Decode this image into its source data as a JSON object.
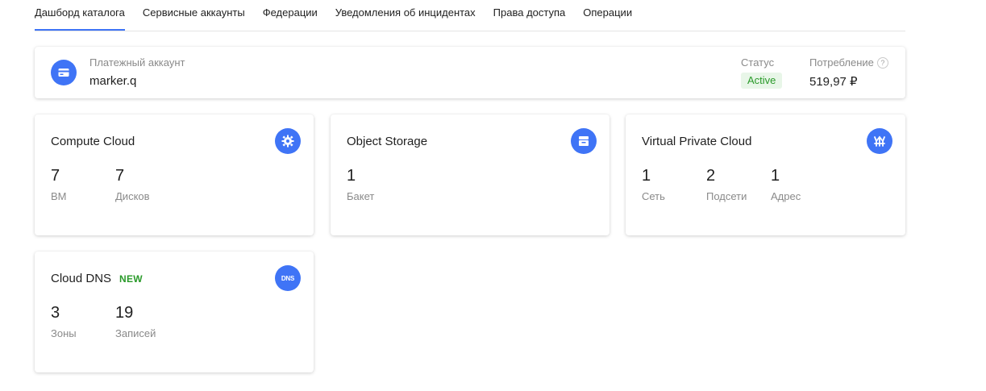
{
  "tabs": [
    {
      "label": "Дашборд каталога",
      "active": true
    },
    {
      "label": "Сервисные аккаунты"
    },
    {
      "label": "Федерации"
    },
    {
      "label": "Уведомления об инцидентах"
    },
    {
      "label": "Права доступа"
    },
    {
      "label": "Операции"
    }
  ],
  "billing": {
    "label": "Платежный аккаунт",
    "name": "marker.q",
    "status_label": "Статус",
    "status_value": "Active",
    "consumption_label": "Потребление",
    "help_glyph": "?",
    "consumption_value": "519,97 ₽",
    "icon": "credit-card-icon"
  },
  "services": {
    "compute": {
      "title": "Compute Cloud",
      "icon": "gear-icon",
      "stats": [
        {
          "value": "7",
          "label": "ВМ"
        },
        {
          "value": "7",
          "label": "Дисков"
        }
      ]
    },
    "storage": {
      "title": "Object Storage",
      "icon": "archive-icon",
      "stats": [
        {
          "value": "1",
          "label": "Бакет"
        }
      ]
    },
    "vpc": {
      "title": "Virtual Private Cloud",
      "icon": "network-icon",
      "stats": [
        {
          "value": "1",
          "label": "Сеть"
        },
        {
          "value": "2",
          "label": "Подсети"
        },
        {
          "value": "1",
          "label": "Адрес"
        }
      ]
    },
    "dns": {
      "title": "Cloud DNS",
      "badge": "NEW",
      "icon": "dns-icon",
      "icon_text": "DNS",
      "stats": [
        {
          "value": "3",
          "label": "Зоны"
        },
        {
          "value": "19",
          "label": "Записей"
        }
      ]
    }
  },
  "colors": {
    "accent": "#3f74f6",
    "status_green": "#2a9a2a",
    "badge_bg": "#e8f6e8"
  }
}
